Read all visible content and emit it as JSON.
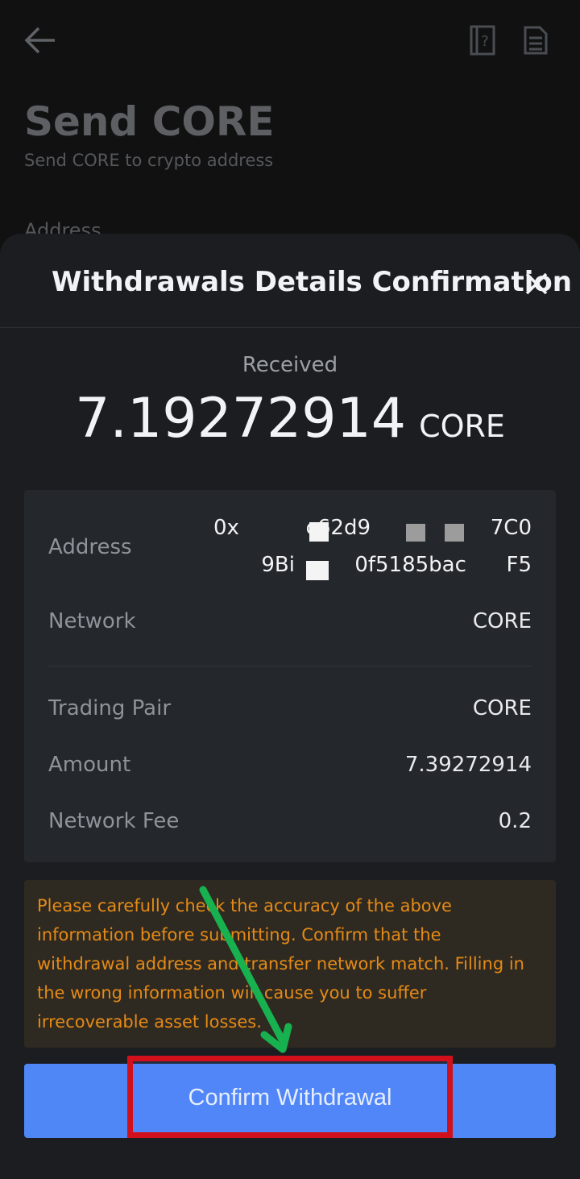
{
  "background_page": {
    "title": "Send CORE",
    "subtitle": "Send CORE to crypto address",
    "address_label": "Address"
  },
  "sheet": {
    "title": "Withdrawals Details Confirmation",
    "received_label": "Received",
    "amount_value": "7.19272914",
    "amount_unit": "CORE",
    "details": {
      "address_label": "Address",
      "address_line1": "0x          c62d9                  7C0",
      "address_line2": "9Bi         0f5185bac      F5",
      "network_label": "Network",
      "network_value": "CORE",
      "trading_pair_label": "Trading Pair",
      "trading_pair_value": "CORE",
      "amount_label": "Amount",
      "amount_value": "7.39272914",
      "fee_label": "Network Fee",
      "fee_value": "0.2"
    },
    "warning": "Please carefully check the accuracy of the above information before submitting. Confirm that the withdrawal address and transfer network match. Filling in the wrong information will cause you to suffer irrecoverable asset losses.",
    "confirm_label": "Confirm Withdrawal"
  },
  "icons": {
    "back": "arrow-left-icon",
    "help": "help-document-icon",
    "records": "document-list-icon",
    "close": "close-icon"
  },
  "colors": {
    "primary_button": "#4f87f7",
    "warning_text": "#e58a16",
    "highlight": "#d1101b",
    "annotation_arrow": "#17b24f"
  }
}
